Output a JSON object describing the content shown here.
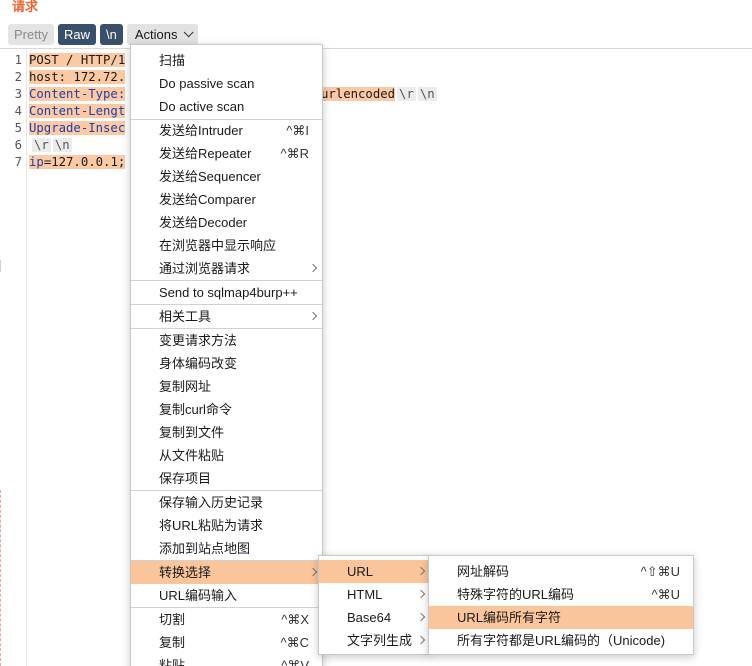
{
  "panel": {
    "title": "请求"
  },
  "toolbar": {
    "pretty": "Pretty",
    "raw": "Raw",
    "newline": "\\n",
    "actions": "Actions"
  },
  "editor": {
    "line_numbers": [
      "1",
      "2",
      "3",
      "4",
      "5",
      "6",
      "7"
    ],
    "lines": [
      {
        "a": "POST / HTTP/1",
        "b": ""
      },
      {
        "a": "host: 172.72.",
        "b": ""
      },
      {
        "a": "Content-Type:",
        "b": "urlencoded"
      },
      {
        "a": "Content-Lengt",
        "b": ""
      },
      {
        "a": "Upgrade-Insec",
        "b": ""
      },
      {
        "a": "",
        "b": ""
      },
      {
        "a": "ip",
        "b": "=127.0.0.1;"
      }
    ],
    "escape_r": "\\r",
    "escape_n": "\\n"
  },
  "menu_main": {
    "items": [
      {
        "label": "扫描",
        "shortcut": ""
      },
      {
        "label": "Do passive scan",
        "shortcut": ""
      },
      {
        "label": "Do active scan",
        "shortcut": ""
      },
      {
        "label": "发送给Intruder",
        "shortcut": "^⌘I"
      },
      {
        "label": "发送给Repeater",
        "shortcut": "^⌘R"
      },
      {
        "label": "发送给Sequencer",
        "shortcut": ""
      },
      {
        "label": "发送给Comparer",
        "shortcut": ""
      },
      {
        "label": "发送给Decoder",
        "shortcut": ""
      },
      {
        "label": "在浏览器中显示响应",
        "shortcut": ""
      },
      {
        "label": "通过浏览器请求",
        "shortcut": ""
      },
      {
        "label": "Send to sqlmap4burp++",
        "shortcut": ""
      },
      {
        "label": "相关工具",
        "shortcut": ""
      },
      {
        "label": "变更请求方法",
        "shortcut": ""
      },
      {
        "label": "身体编码改变",
        "shortcut": ""
      },
      {
        "label": "复制网址",
        "shortcut": ""
      },
      {
        "label": "复制curl命令",
        "shortcut": ""
      },
      {
        "label": "复制到文件",
        "shortcut": ""
      },
      {
        "label": "从文件粘贴",
        "shortcut": ""
      },
      {
        "label": "保存项目",
        "shortcut": ""
      },
      {
        "label": "保存输入历史记录",
        "shortcut": ""
      },
      {
        "label": "将URL粘贴为请求",
        "shortcut": ""
      },
      {
        "label": "添加到站点地图",
        "shortcut": ""
      },
      {
        "label": "转换选择",
        "shortcut": ""
      },
      {
        "label": "URL编码输入",
        "shortcut": ""
      },
      {
        "label": "切割",
        "shortcut": "^⌘X"
      },
      {
        "label": "复制",
        "shortcut": "^⌘C"
      },
      {
        "label": "粘贴",
        "shortcut": "^⌘V"
      }
    ]
  },
  "menu_convert": {
    "items": [
      {
        "label": "URL"
      },
      {
        "label": "HTML"
      },
      {
        "label": "Base64"
      },
      {
        "label": "文字列生成"
      }
    ]
  },
  "menu_url": {
    "items": [
      {
        "label": "网址解码",
        "shortcut": "^⇧⌘U"
      },
      {
        "label": "特殊字符的URL编码",
        "shortcut": "^⌘U"
      },
      {
        "label": "URL编码所有字符",
        "shortcut": ""
      },
      {
        "label": "所有字符都是URL编码的（Unicode)",
        "shortcut": ""
      }
    ]
  },
  "colors": {
    "accent": "#e8683a",
    "selection": "#fbc59b",
    "highlight": "#fcc9a5",
    "button_dark": "#3a4f6a"
  }
}
